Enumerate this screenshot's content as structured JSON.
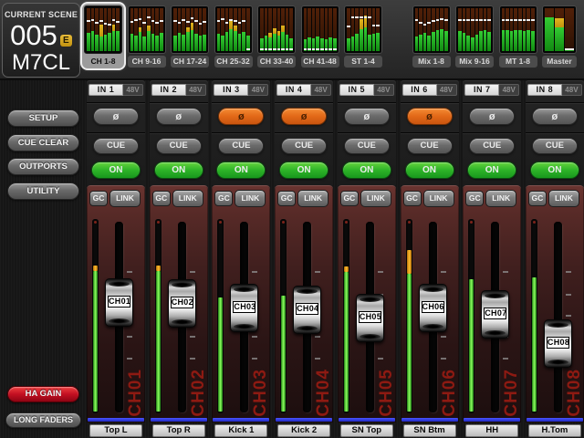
{
  "scene": {
    "label": "CURRENT SCENE",
    "number": "005",
    "edit_badge": "E",
    "console": "M7CL"
  },
  "sidebar": {
    "buttons": [
      {
        "label": "SETUP"
      },
      {
        "label": "CUE CLEAR"
      },
      {
        "label": "OUTPORTS"
      },
      {
        "label": "UTILITY"
      }
    ],
    "ha_gain": {
      "label": "HA GAIN",
      "active": true,
      "color": "#c31022"
    },
    "long_faders": {
      "label": "LONG FADERS"
    }
  },
  "tabs": [
    {
      "label": "CH 1-8",
      "selected": true,
      "gap_before": false,
      "narrow": false,
      "bars": [
        {
          "g": 0.42,
          "d": 0.3
        },
        {
          "g": 0.46,
          "d": 0.27
        },
        {
          "g": 0.38,
          "d": 0.33
        },
        {
          "g": 0.34,
          "t": 0.28,
          "d": 0.3
        },
        {
          "g": 0.38,
          "d": 0.36
        },
        {
          "g": 0.42,
          "d": 0.38
        },
        {
          "g": 0.46,
          "t": 0.16,
          "d": 0.27
        },
        {
          "g": 0.46,
          "d": 0.32
        }
      ]
    },
    {
      "label": "CH 9-16",
      "selected": false,
      "gap_before": false,
      "narrow": false,
      "bars": [
        {
          "g": 0.4,
          "d": 0.32
        },
        {
          "g": 0.36,
          "d": 0.28
        },
        {
          "g": 0.44,
          "t": 0.12,
          "d": 0.25
        },
        {
          "g": 0.34,
          "d": 0.33
        },
        {
          "g": 0.46,
          "t": 0.14,
          "d": 0.22
        },
        {
          "g": 0.4,
          "d": 0.3
        },
        {
          "g": 0.36,
          "d": 0.34
        },
        {
          "g": 0.42,
          "d": 0.3
        }
      ]
    },
    {
      "label": "CH 17-24",
      "selected": false,
      "gap_before": false,
      "narrow": false,
      "bars": [
        {
          "g": 0.36,
          "d": 0.3
        },
        {
          "g": 0.42,
          "d": 0.34
        },
        {
          "g": 0.38,
          "d": 0.28
        },
        {
          "g": 0.44,
          "t": 0.12,
          "d": 0.32
        },
        {
          "g": 0.48,
          "t": 0.18,
          "d": 0.24
        },
        {
          "g": 0.4,
          "d": 0.3
        },
        {
          "g": 0.36,
          "d": 0.36
        },
        {
          "g": 0.38,
          "d": 0.32
        }
      ]
    },
    {
      "label": "CH 25-32",
      "selected": false,
      "gap_before": false,
      "narrow": false,
      "bars": [
        {
          "g": 0.4,
          "d": 0.3
        },
        {
          "g": 0.36,
          "d": 0.26
        },
        {
          "g": 0.44,
          "d": 0.33
        },
        {
          "g": 0.52,
          "t": 0.2,
          "d": 0.28
        },
        {
          "g": 0.46,
          "t": 0.14,
          "d": 0.3
        },
        {
          "g": 0.4,
          "d": 0.34
        },
        {
          "g": 0.44,
          "d": 0.3
        },
        {
          "g": 0.36,
          "d": 0.95
        }
      ]
    },
    {
      "label": "CH 33-40",
      "selected": false,
      "gap_before": false,
      "narrow": false,
      "bars": [
        {
          "g": 0.3,
          "d": 0.95
        },
        {
          "g": 0.36,
          "d": 0.95
        },
        {
          "g": 0.32,
          "t": 0.1,
          "d": 0.95
        },
        {
          "g": 0.4,
          "t": 0.14,
          "d": 0.95
        },
        {
          "g": 0.36,
          "t": 0.1,
          "d": 0.95
        },
        {
          "g": 0.44,
          "t": 0.16,
          "d": 0.95
        },
        {
          "g": 0.38,
          "d": 0.95
        },
        {
          "g": 0.3,
          "d": 0.95
        }
      ]
    },
    {
      "label": "CH 41-48",
      "selected": false,
      "gap_before": false,
      "narrow": false,
      "bars": [
        {
          "g": 0.28,
          "d": 0.95
        },
        {
          "g": 0.32,
          "d": 0.95
        },
        {
          "g": 0.3,
          "d": 0.95
        },
        {
          "g": 0.34,
          "d": 0.95
        },
        {
          "g": 0.3,
          "d": 0.95
        },
        {
          "g": 0.28,
          "d": 0.95
        },
        {
          "g": 0.32,
          "d": 0.95
        },
        {
          "g": 0.3,
          "d": 0.95
        }
      ]
    },
    {
      "label": "ST 1-4",
      "selected": false,
      "gap_before": false,
      "narrow": false,
      "bars": [
        {
          "g": 0.3,
          "d": 0.42
        },
        {
          "g": 0.34,
          "d": 0.22
        },
        {
          "g": 0.4,
          "d": 0.22
        },
        {
          "g": 0.52,
          "t": 0.22,
          "d": 0.22
        },
        {
          "g": 0.56,
          "t": 0.26,
          "d": 0.22
        },
        {
          "g": 0.38,
          "d": 0.22
        },
        {
          "g": 0.4,
          "d": 0.4
        },
        {
          "g": 0.42,
          "d": 0.4
        }
      ]
    },
    {
      "label": "Mix 1-8",
      "selected": false,
      "gap_before": true,
      "narrow": false,
      "bars": [
        {
          "g": 0.34,
          "d": 0.28
        },
        {
          "g": 0.38,
          "d": 0.34
        },
        {
          "g": 0.42,
          "d": 0.38
        },
        {
          "g": 0.36,
          "d": 0.34
        },
        {
          "g": 0.44,
          "d": 0.3
        },
        {
          "g": 0.48,
          "d": 0.28
        },
        {
          "g": 0.52,
          "d": 0.26
        },
        {
          "g": 0.46,
          "d": 0.28
        }
      ]
    },
    {
      "label": "Mix 9-16",
      "selected": false,
      "gap_before": false,
      "narrow": false,
      "bars": [
        {
          "g": 0.46,
          "d": 0.27
        },
        {
          "g": 0.42,
          "d": 0.27
        },
        {
          "g": 0.36,
          "d": 0.27
        },
        {
          "g": 0.32,
          "d": 0.27
        },
        {
          "g": 0.38,
          "d": 0.27
        },
        {
          "g": 0.46,
          "d": 0.27
        },
        {
          "g": 0.5,
          "d": 0.27
        },
        {
          "g": 0.44,
          "d": 0.27
        }
      ]
    },
    {
      "label": "MT 1-8",
      "selected": false,
      "gap_before": false,
      "narrow": false,
      "bars": [
        {
          "g": 0.48,
          "d": 0.27
        },
        {
          "g": 0.5,
          "d": 0.27
        },
        {
          "g": 0.46,
          "d": 0.27
        },
        {
          "g": 0.48,
          "d": 0.27
        },
        {
          "g": 0.5,
          "d": 0.27
        },
        {
          "g": 0.46,
          "d": 0.27
        },
        {
          "g": 0.48,
          "d": 0.27
        },
        {
          "g": 0.46,
          "d": 0.27
        }
      ]
    },
    {
      "label": "Master",
      "selected": false,
      "gap_before": false,
      "narrow": true,
      "bars": [
        {
          "g": 0.78
        },
        {
          "g": 0.55,
          "t": 0.22
        },
        {
          "g": 0.04,
          "d": 0.95
        }
      ]
    }
  ],
  "strip_controls": {
    "phase_symbol": "ø",
    "cue_label": "CUE",
    "on_label": "ON",
    "gc_label": "GC",
    "link_label": "LINK",
    "phantom_label": "48V"
  },
  "channels": [
    {
      "input": "IN 1",
      "id": "CH01",
      "name": "Top L",
      "phase_inverted": false,
      "on": true,
      "fader_pos": 0.603,
      "meter": {
        "level": 0.765,
        "tip": 0.03
      }
    },
    {
      "input": "IN 2",
      "id": "CH02",
      "name": "Top R",
      "phase_inverted": false,
      "on": true,
      "fader_pos": 0.596,
      "meter": {
        "level": 0.765,
        "tip": 0.03
      }
    },
    {
      "input": "IN 3",
      "id": "CH03",
      "name": "Kick 1",
      "phase_inverted": true,
      "on": true,
      "fader_pos": 0.564,
      "meter": {
        "level": 0.598,
        "tip": 0
      }
    },
    {
      "input": "IN 4",
      "id": "CH04",
      "name": "Kick 2",
      "phase_inverted": true,
      "on": true,
      "fader_pos": 0.551,
      "meter": {
        "level": 0.608,
        "tip": 0
      }
    },
    {
      "input": "IN 5",
      "id": "CH05",
      "name": "SN Top",
      "phase_inverted": false,
      "on": true,
      "fader_pos": 0.494,
      "meter": {
        "level": 0.761,
        "tip": 0.03
      }
    },
    {
      "input": "IN 6",
      "id": "CH06",
      "name": "SN Btm",
      "phase_inverted": true,
      "on": true,
      "fader_pos": 0.564,
      "meter": {
        "level": 0.847,
        "tip": 0.125
      }
    },
    {
      "input": "IN 7",
      "id": "CH07",
      "name": "HH",
      "phase_inverted": false,
      "on": true,
      "fader_pos": 0.519,
      "meter": {
        "level": 0.694,
        "tip": 0
      }
    },
    {
      "input": "IN 8",
      "id": "CH08",
      "name": "H.Tom",
      "phase_inverted": false,
      "on": true,
      "fader_pos": 0.314,
      "meter": {
        "level": 0.703,
        "tip": 0
      }
    }
  ],
  "fader_ticks_y": [
    94,
    119,
    142,
    165,
    189
  ]
}
